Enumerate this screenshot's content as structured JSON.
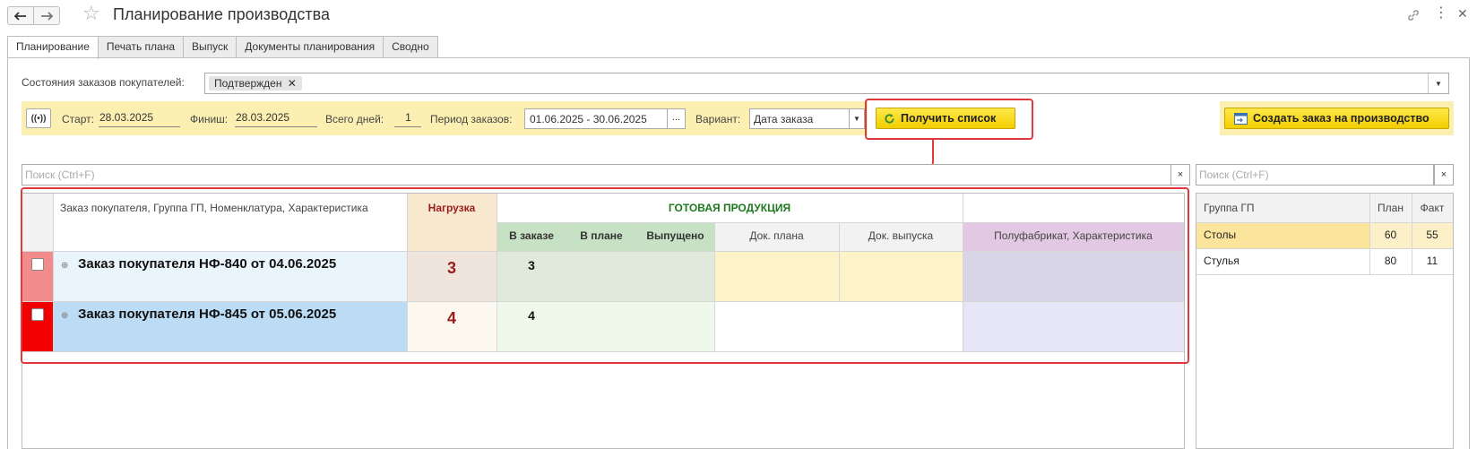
{
  "window": {
    "title": "Планирование производства",
    "back_icon": "arrow-left-icon",
    "forward_icon": "arrow-right-icon",
    "favorite_icon": "star-icon",
    "link_icon": "link-icon",
    "more_icon": "more-vertical-icon",
    "close_icon": "close-icon"
  },
  "tabs": [
    {
      "label": "Планирование",
      "active": true
    },
    {
      "label": "Печать плана",
      "active": false
    },
    {
      "label": "Выпуск",
      "active": false
    },
    {
      "label": "Документы планирования",
      "active": false
    },
    {
      "label": "Сводно",
      "active": false
    }
  ],
  "filter": {
    "label": "Состояния заказов покупателей:",
    "chip": "Подтвержден",
    "chip_remove": "✕"
  },
  "toolbar": {
    "start_label": "Старт:",
    "start_value": "28.03.2025",
    "finish_label": "Финиш:",
    "finish_value": "28.03.2025",
    "days_label": "Всего дней:",
    "days_value": "1",
    "period_label": "Период заказов:",
    "period_value": "01.06.2025 - 30.06.2025",
    "period_button": "...",
    "variant_label": "Вариант:",
    "variant_value": "Дата заказа",
    "get_list_button": "Получить список",
    "create_order_button": "Создать заказ на производство"
  },
  "search": {
    "placeholder": "Поиск (Ctrl+F)",
    "clear": "×"
  },
  "grid": {
    "col_main": "Заказ покупателя, Группа ГП, Номенклатура, Характеристика",
    "col_load": "Нагрузка",
    "group_ready": "ГОТОВАЯ ПРОДУКЦИЯ",
    "col_in_order": "В заказе",
    "col_in_plan": "В плане",
    "col_released": "Выпущено",
    "col_plan_doc": "Док. плана",
    "col_release_doc": "Док. выпуска",
    "col_semi": "Полуфабрикат, Характеристика",
    "rows": [
      {
        "title": "Заказ покупателя НФ-840 от 04.06.2025",
        "load": "3",
        "in_order": "3"
      },
      {
        "title": "Заказ покупателя НФ-845 от 05.06.2025",
        "load": "4",
        "in_order": "4"
      }
    ]
  },
  "side_table": {
    "col_group": "Группа ГП",
    "col_plan": "План",
    "col_fact": "Факт",
    "rows": [
      {
        "group": "Столы",
        "plan": "60",
        "fact": "55"
      },
      {
        "group": "Стулья",
        "plan": "80",
        "fact": "11"
      }
    ]
  },
  "colors": {
    "highlight_border": "#e0393c",
    "yellow_bar": "#fbf0b2",
    "button_yellow": "#f6d400",
    "green_header": "#1d7a1d",
    "load_red": "#9b1c1c"
  }
}
